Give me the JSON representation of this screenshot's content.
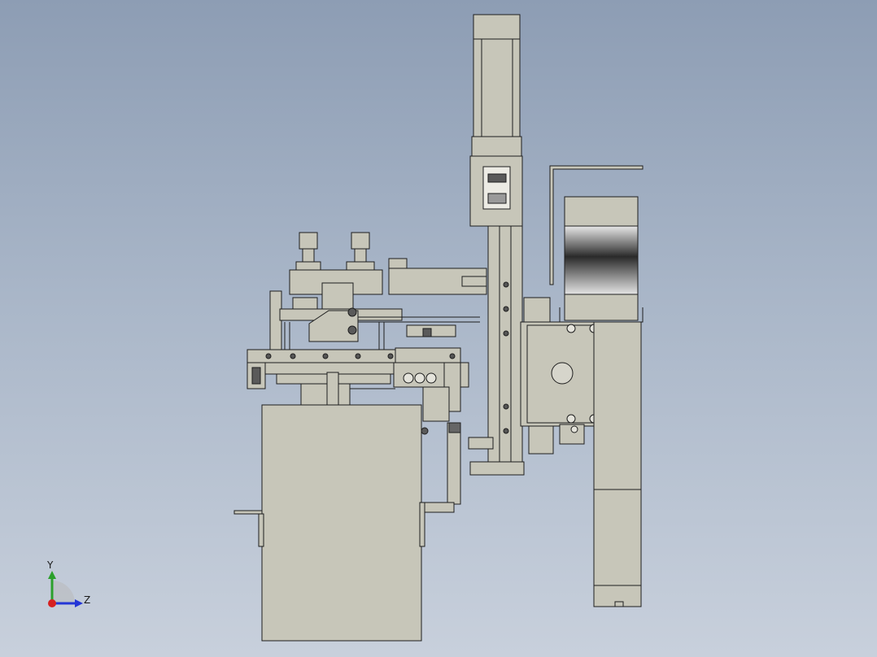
{
  "viewport": {
    "background_top": "#8d9db4",
    "background_bottom": "#c8d0dc",
    "part_fill": "#c7c6b9",
    "part_stroke": "#1e1e1e"
  },
  "triad": {
    "y_label": "Y",
    "z_label": "Z",
    "y_color": "#2ba02b",
    "z_color": "#2436d6",
    "x_color": "#d62020"
  }
}
